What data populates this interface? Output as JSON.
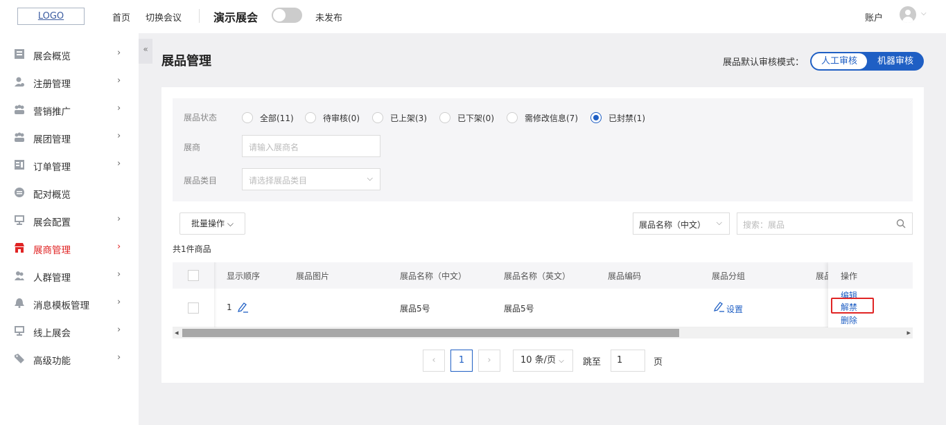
{
  "header": {
    "logo": "LOGO",
    "nav": [
      "首页",
      "切换会议"
    ],
    "conference_name": "演示展会",
    "publish_status": "未发布",
    "account": "账户"
  },
  "sidebar": {
    "items": [
      {
        "label": "展会概览",
        "icon": "overview-icon",
        "arrow": "›"
      },
      {
        "label": "注册管理",
        "icon": "user-register-icon",
        "arrow": "›"
      },
      {
        "label": "营销推广",
        "icon": "marketing-icon",
        "arrow": "›"
      },
      {
        "label": "展团管理",
        "icon": "group-icon",
        "arrow": "›"
      },
      {
        "label": "订单管理",
        "icon": "order-icon",
        "arrow": "›"
      },
      {
        "label": "配对概览",
        "icon": "match-icon",
        "arrow": ""
      },
      {
        "label": "展会配置",
        "icon": "config-icon",
        "arrow": "›"
      },
      {
        "label": "展商管理",
        "icon": "exhibitor-icon",
        "arrow": "›"
      },
      {
        "label": "人群管理",
        "icon": "crowd-icon",
        "arrow": "›"
      },
      {
        "label": "消息模板管理",
        "icon": "bell-icon",
        "arrow": "›"
      },
      {
        "label": "线上展会",
        "icon": "online-icon",
        "arrow": "›"
      },
      {
        "label": "高级功能",
        "icon": "tag-icon",
        "arrow": "›"
      }
    ],
    "active_index": 7,
    "collapse_glyph": "«"
  },
  "page": {
    "title": "展品管理",
    "audit_label": "展品默认审核模式：",
    "audit_options": [
      "人工审核",
      "机器审核"
    ],
    "audit_selected": "人工审核"
  },
  "filters": {
    "status_label": "展品状态",
    "status_options": [
      "全部(11)",
      "待审核(0)",
      "已上架(3)",
      "已下架(0)",
      "需修改信息(7)",
      "已封禁(1)"
    ],
    "status_selected": "已封禁(1)",
    "exhibitor_label": "展商",
    "exhibitor_placeholder": "请输入展商名",
    "category_label": "展品类目",
    "category_placeholder": "请选择展品类目"
  },
  "toolbar": {
    "batch_label": "批量操作",
    "search_field": "展品名称（中文）",
    "search_placeholder": "搜索：展品",
    "count_text": "共1件商品"
  },
  "table": {
    "columns": [
      "显示顺序",
      "展品图片",
      "展品名称（中文）",
      "展品名称（英文）",
      "展品编码",
      "展品分组",
      "展品",
      "操作"
    ],
    "rows": [
      {
        "order": "1",
        "name_cn": "展品5号",
        "name_en": "展品5号",
        "code": "",
        "group_action": "设置",
        "actions": [
          "编辑",
          "解禁",
          "删除"
        ]
      }
    ]
  },
  "pagination": {
    "prev": "‹",
    "current_page": "1",
    "next": "›",
    "page_size": "10 条/页",
    "jump_label": "跳至",
    "jump_value": "1",
    "page_unit": "页"
  },
  "colors": {
    "accent": "#1f5fc4",
    "active_menu": "#e02424",
    "highlight_box": "#e02424"
  }
}
